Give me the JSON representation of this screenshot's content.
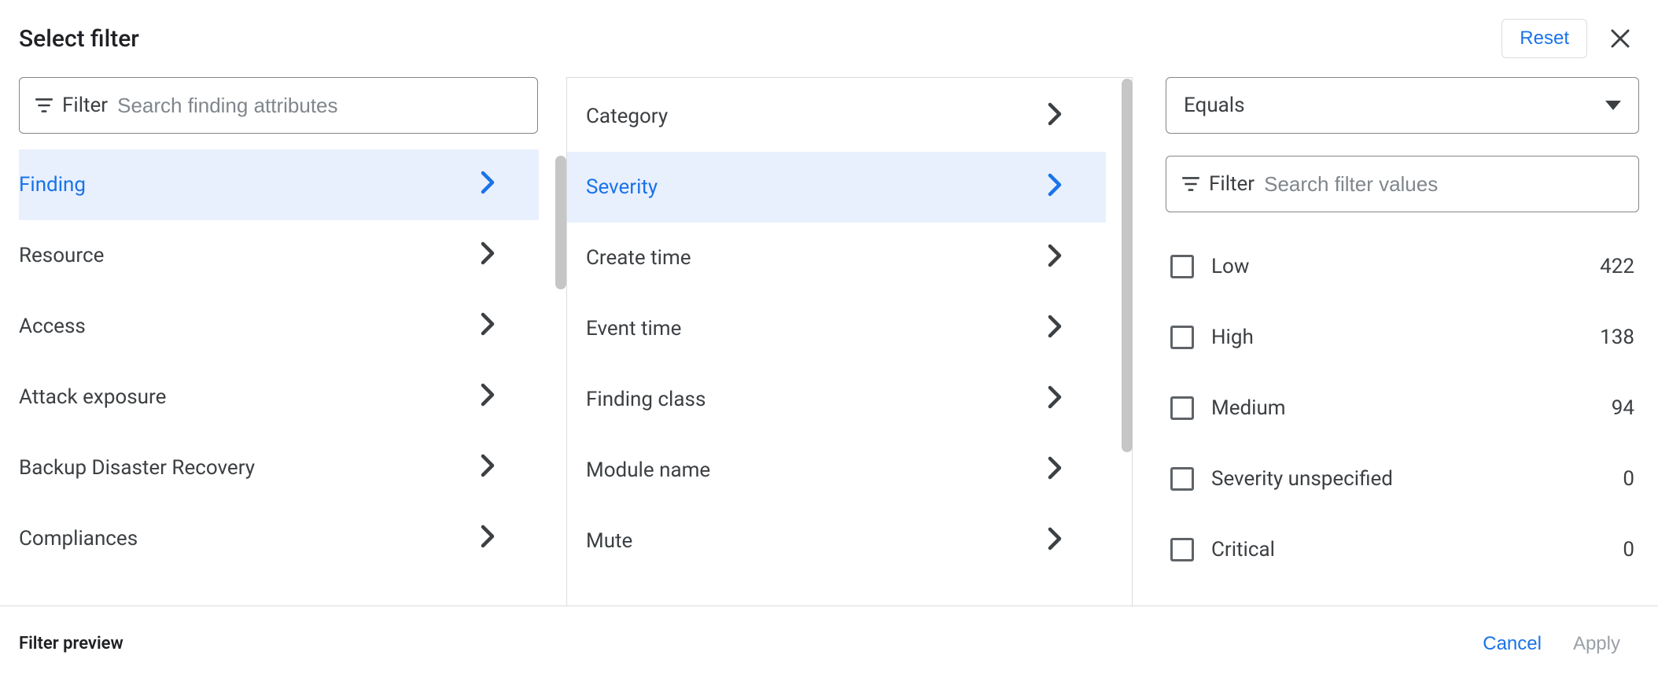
{
  "header": {
    "title": "Select filter",
    "reset": "Reset"
  },
  "col1": {
    "filter_label": "Filter",
    "filter_placeholder": "Search finding attributes",
    "items": [
      "Finding",
      "Resource",
      "Access",
      "Attack exposure",
      "Backup Disaster Recovery",
      "Compliances"
    ],
    "selected_index": 0
  },
  "col2": {
    "items": [
      "Category",
      "Severity",
      "Create time",
      "Event time",
      "Finding class",
      "Module name",
      "Mute"
    ],
    "selected_index": 1
  },
  "col3": {
    "operator": "Equals",
    "filter_label": "Filter",
    "filter_placeholder": "Search filter values",
    "values": [
      {
        "label": "Low",
        "count": 422
      },
      {
        "label": "High",
        "count": 138
      },
      {
        "label": "Medium",
        "count": 94
      },
      {
        "label": "Severity unspecified",
        "count": 0
      },
      {
        "label": "Critical",
        "count": 0
      }
    ]
  },
  "footer": {
    "preview": "Filter preview",
    "cancel": "Cancel",
    "apply": "Apply"
  }
}
